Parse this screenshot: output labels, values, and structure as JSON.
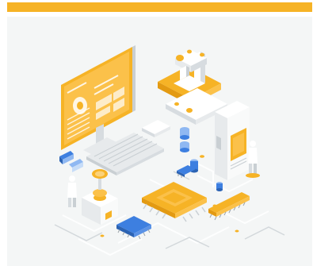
{
  "card": {
    "accent_color": "#f6b326",
    "panel_color": "#f4f6f6",
    "illustration": "isometric-electronics-lab-illustration"
  },
  "colors": {
    "orange": "#f6b326",
    "orange_light": "#fbd27a",
    "orange_dark": "#e39a12",
    "white": "#ffffff",
    "gray_light": "#e7eaec",
    "gray": "#c9cfd3",
    "gray_dark": "#9aa3aa",
    "blue": "#3d7fe0",
    "blue_light": "#8fb8f2"
  },
  "icons": [
    "computer-monitor-icon",
    "keyboard-icon",
    "computer-mouse-icon",
    "microscope-icon",
    "server-cabinet-icon",
    "cpu-chip-icon",
    "ic-chip-icon",
    "processor-module-icon",
    "capacitor-icon",
    "engineer-figure-icon"
  ]
}
